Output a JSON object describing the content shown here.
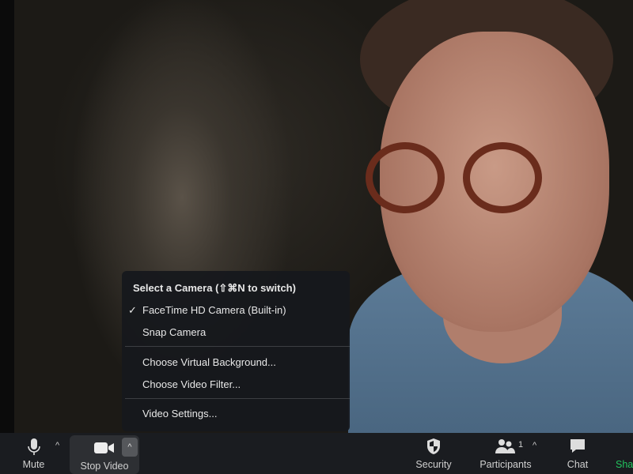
{
  "camera_menu": {
    "header": "Select a Camera (⇧⌘N to switch)",
    "items": [
      {
        "label": "FaceTime HD Camera (Built-in)",
        "checked": true
      },
      {
        "label": "Snap Camera",
        "checked": false
      }
    ],
    "actions": [
      "Choose Virtual Background...",
      "Choose Video Filter..."
    ],
    "settings": "Video Settings...",
    "check_glyph": "✓"
  },
  "toolbar": {
    "mute": "Mute",
    "stop_video": "Stop Video",
    "security": "Security",
    "participants": "Participants",
    "participants_count": "1",
    "chat": "Chat",
    "share": "Sha",
    "share_color": "#22c55e",
    "caret": "^"
  }
}
